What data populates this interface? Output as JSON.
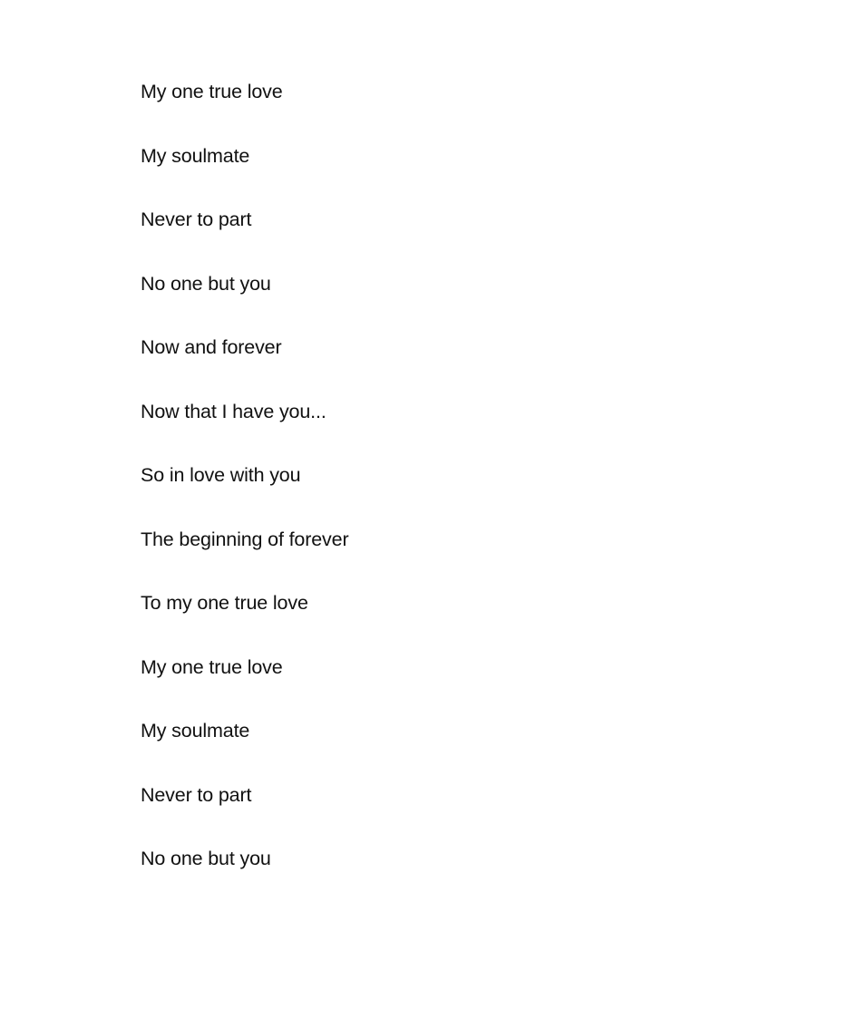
{
  "document": {
    "background_color": "#ffffff",
    "text_color": "#111111",
    "lines": [
      {
        "text": "My one true love"
      },
      {
        "text": "My soulmate"
      },
      {
        "text": "Never to part"
      },
      {
        "text": "No one but you"
      },
      {
        "text": "Now and forever"
      },
      {
        "text": "Now that I have you..."
      },
      {
        "text": "So in love with you"
      },
      {
        "text": "The beginning of forever"
      },
      {
        "text": "To my one true love"
      },
      {
        "text": "My one true love"
      },
      {
        "text": "My soulmate"
      },
      {
        "text": "Never to part"
      },
      {
        "text": "No one but you"
      }
    ]
  }
}
